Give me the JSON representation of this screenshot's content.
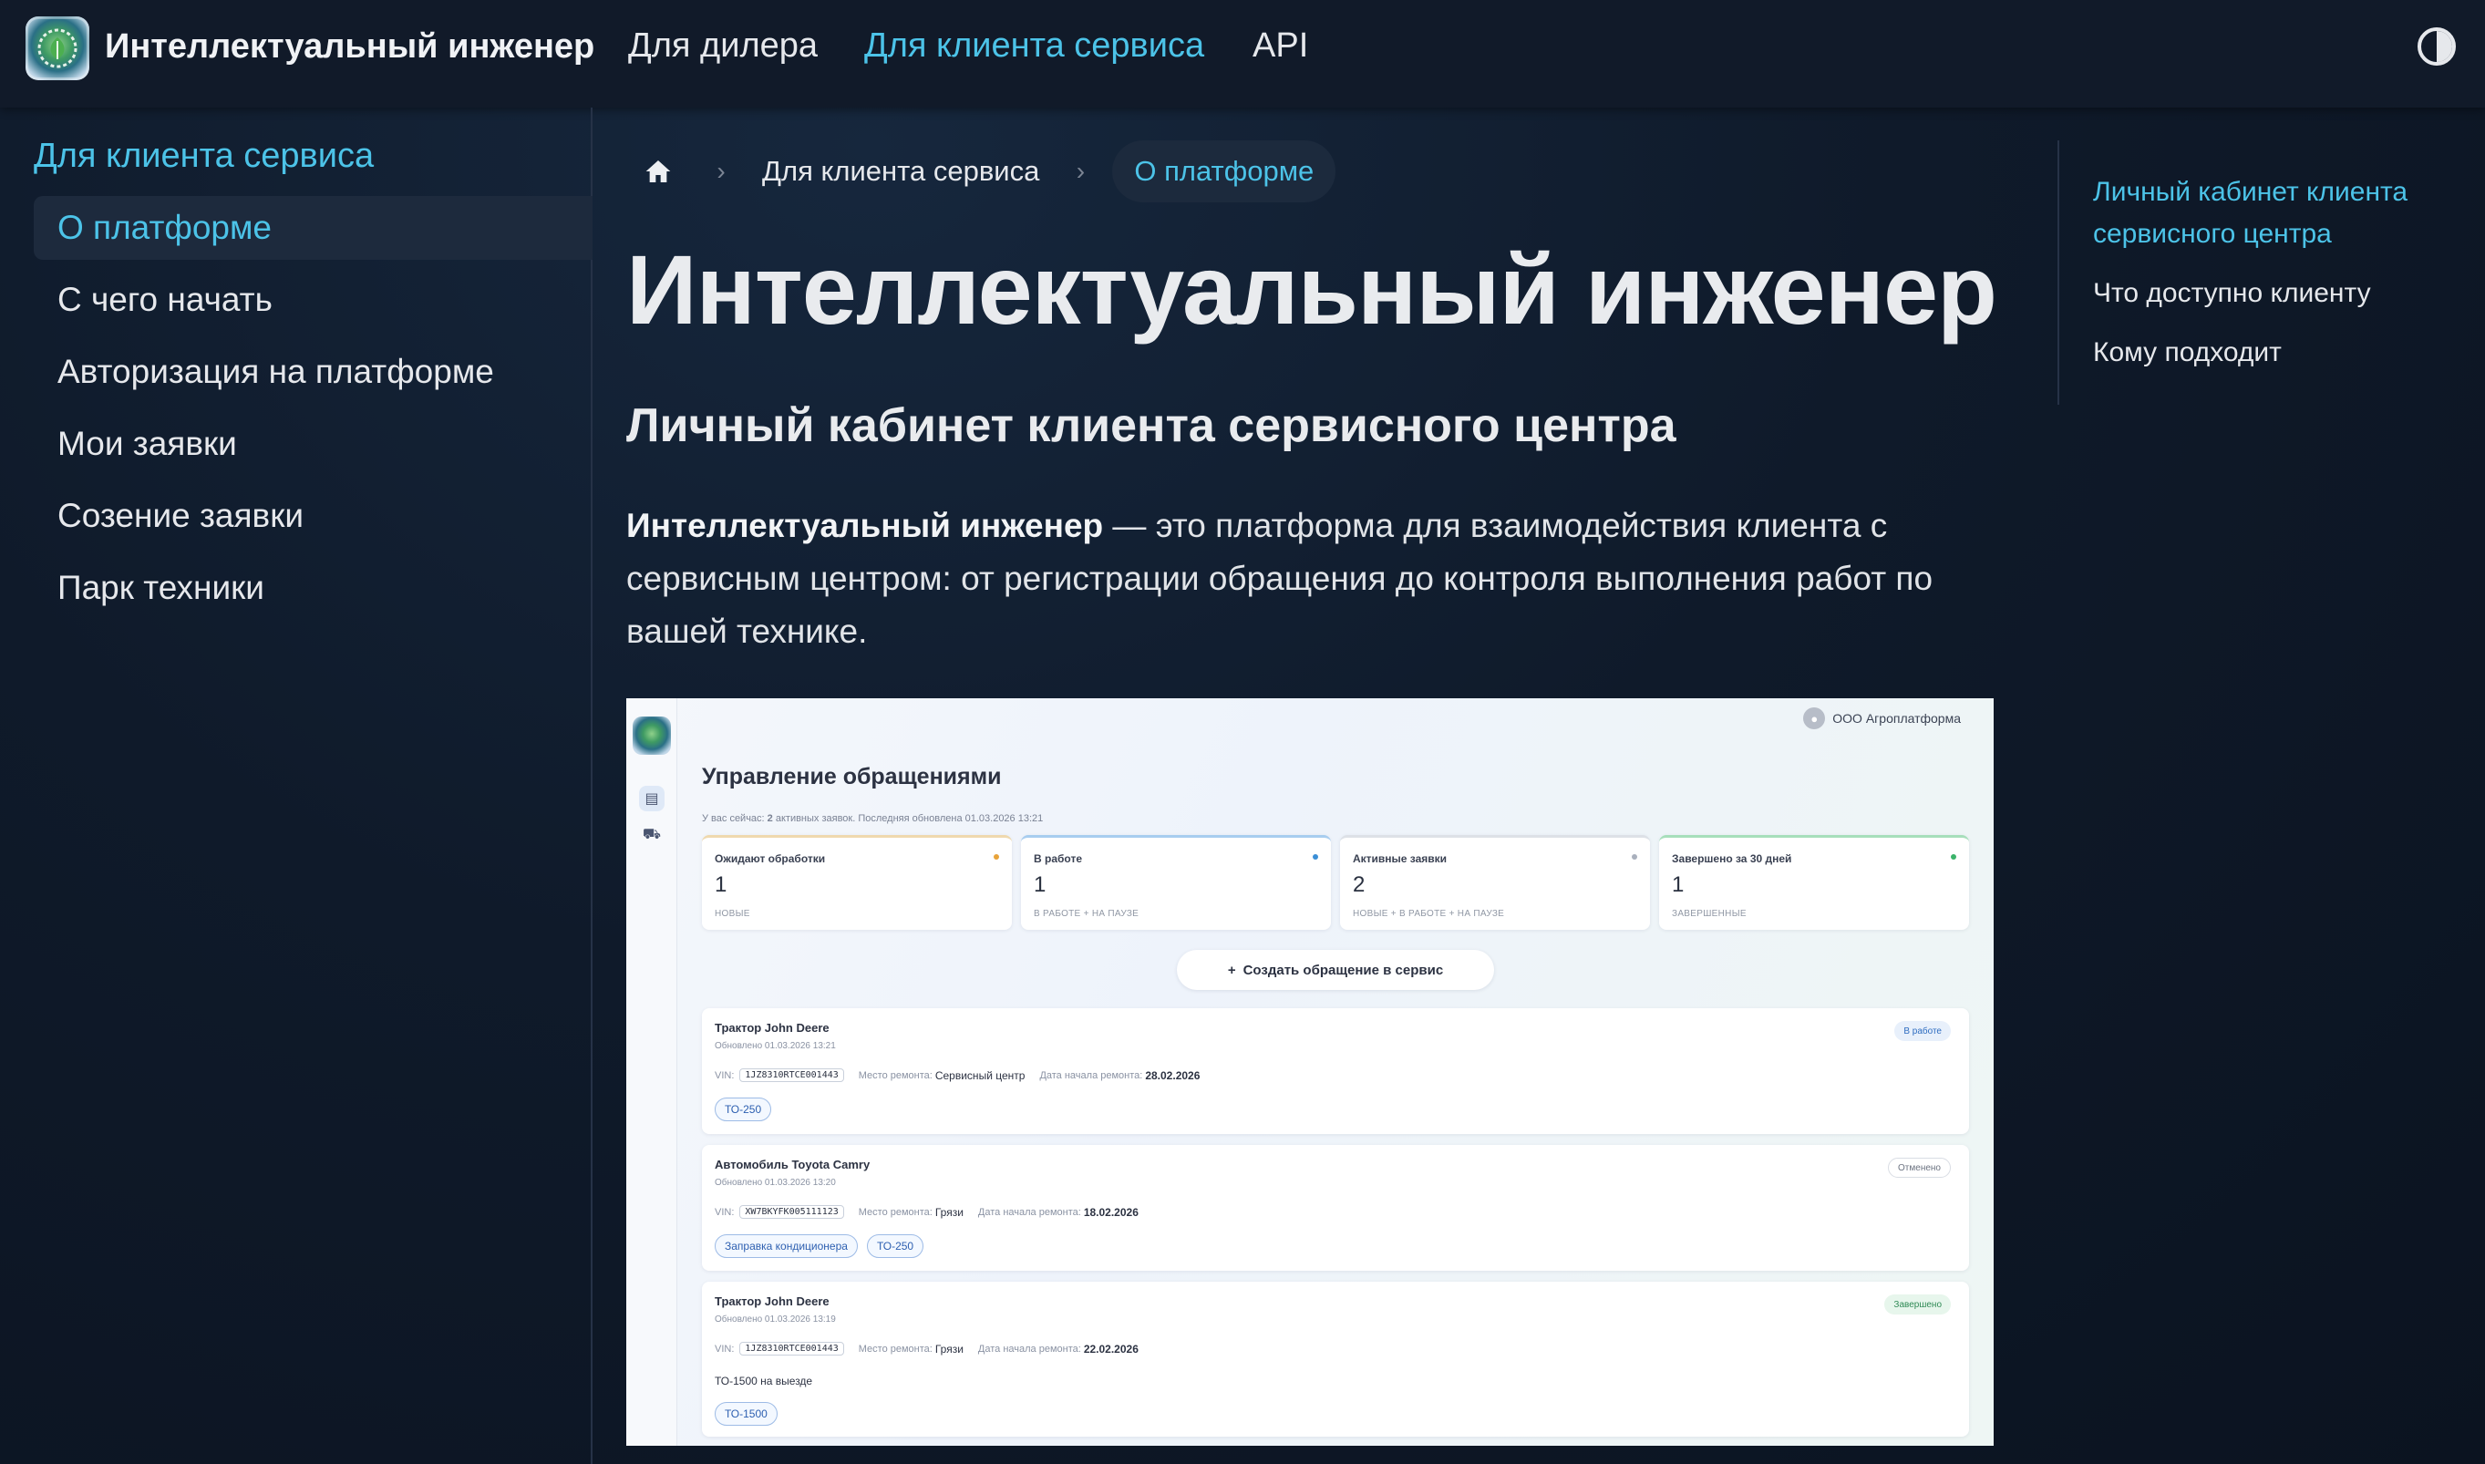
{
  "navbar": {
    "brand": "Интеллектуальный инженер",
    "links": [
      {
        "label": "Для дилера",
        "active": false
      },
      {
        "label": "Для клиента сервиса",
        "active": true
      },
      {
        "label": "API",
        "active": false
      }
    ],
    "theme_toggle_icon": "half-circle-contrast-icon"
  },
  "sidebar": {
    "heading": "Для клиента сервиса",
    "items": [
      {
        "label": "О платформе",
        "active": true
      },
      {
        "label": "С чего начать",
        "active": false
      },
      {
        "label": "Авторизация на платформе",
        "active": false
      },
      {
        "label": "Мои заявки",
        "active": false
      },
      {
        "label": "Созение заявки",
        "active": false
      },
      {
        "label": "Парк техники",
        "active": false
      }
    ]
  },
  "breadcrumb": {
    "home_icon": "home-icon",
    "parent": "Для клиента сервиса",
    "current": "О платформе"
  },
  "main": {
    "title": "Интеллектуальный инженер",
    "section_heading": "Личный кабинет клиента сервисного центра",
    "intro_bold": "Интеллектуальный инженер",
    "intro_rest": " — это платформа для взаимодействия клиента с сервисным центром: от регистрации обращения до контроля выполнения работ по вашей технике."
  },
  "toc": {
    "items": [
      {
        "label": "Личный кабинет клиента сервисного центра",
        "active": true
      },
      {
        "label": "Что доступно клиенту",
        "active": false
      },
      {
        "label": "Кому подходит",
        "active": false
      }
    ]
  },
  "screenshot": {
    "user": "ООО Агроплатформа",
    "title": "Управление обращениями",
    "subtitle_prefix": "У вас сейчас: ",
    "subtitle_count": "2",
    "subtitle_suffix": " активных заявок. Последняя обновлена 01.03.2026 13:21",
    "stats": [
      {
        "label": "Ожидают обработки",
        "value": "1",
        "caption": "НОВЫЕ",
        "color": "#e8a33a"
      },
      {
        "label": "В работе",
        "value": "1",
        "caption": "В РАБОТЕ + НА ПАУЗЕ",
        "color": "#3b8fd6"
      },
      {
        "label": "Активные заявки",
        "value": "2",
        "caption": "НОВЫЕ + В РАБОТЕ + НА ПАУЗЕ",
        "color": "#a9b0bd"
      },
      {
        "label": "Завершено за 30 дней",
        "value": "1",
        "caption": "ЗАВЕРШЕННЫЕ",
        "color": "#3bb36a"
      }
    ],
    "create_button": "Создать обращение в сервис",
    "vin_label": "VIN:",
    "place_label": "Место ремонта:",
    "date_label": "Дата начала ремонта:",
    "requests": [
      {
        "title": "Трактор John Deere",
        "updated": "Обновлено 01.03.2026 13:21",
        "status": "В работе",
        "status_color": "#2d6cc0",
        "vin": "1JZ8310RTCE001443",
        "place": "Сервисный центр",
        "date": "28.02.2026",
        "note": "",
        "tags": [
          "ТО-250"
        ]
      },
      {
        "title": "Автомобиль Toyota Camry",
        "updated": "Обновлено 01.03.2026 13:20",
        "status": "Отменено",
        "status_color": "#6b7280",
        "vin": "XW7BKYFK005111123",
        "place": "Грязи",
        "date": "18.02.2026",
        "note": "",
        "tags": [
          "Заправка кондиционера",
          "ТО-250"
        ]
      },
      {
        "title": "Трактор John Deere",
        "updated": "Обновлено 01.03.2026 13:19",
        "status": "Завершено",
        "status_color": "#2f8a55",
        "vin": "1JZ8310RTCE001443",
        "place": "Грязи",
        "date": "22.02.2026",
        "note": "ТО-1500 на выезде",
        "tags": [
          "ТО-1500"
        ]
      }
    ]
  }
}
